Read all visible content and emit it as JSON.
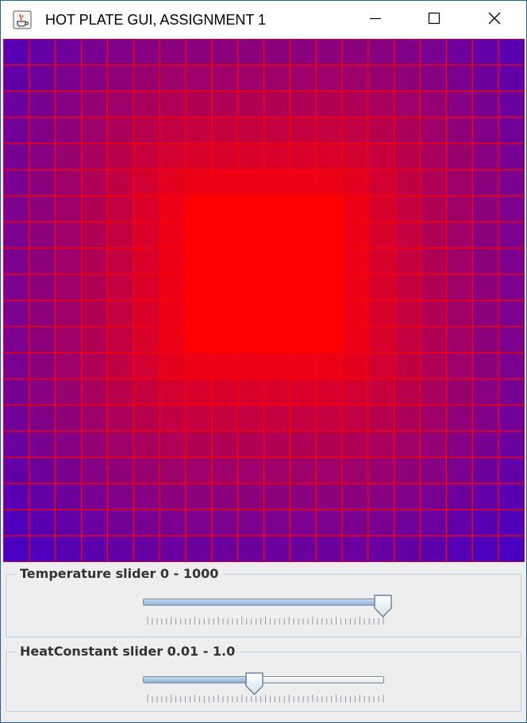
{
  "window": {
    "title": "HOT PLATE GUI, ASSIGNMENT 1",
    "icon": "java-cup-icon",
    "buttons": [
      "minimize-icon",
      "maximize-icon",
      "close-icon"
    ],
    "border_color": "#1f5fa8"
  },
  "plate": {
    "rows": 20,
    "cols": 20,
    "grid_color": "#ff0000",
    "hot_color": "#ff0000",
    "cold_color": "#4a00c0",
    "hot_region": {
      "row_start": 6,
      "row_end": 11,
      "col_start": 7,
      "col_end": 12
    }
  },
  "sliders": [
    {
      "label": "Temperature slider 0 - 1000",
      "min": 0,
      "max": 1000,
      "value": 1000
    },
    {
      "label": "HeatConstant slider 0.01 - 1.0",
      "min": 0.01,
      "max": 1.0,
      "value": 0.47
    }
  ],
  "colors": {
    "panel_bg": "#eeeeee",
    "group_border": "#b8cfe5"
  }
}
